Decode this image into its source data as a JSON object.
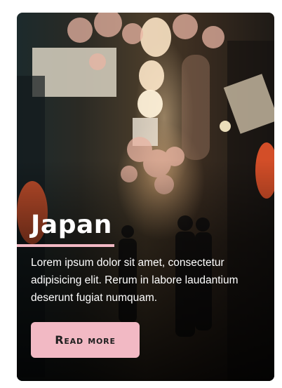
{
  "card": {
    "title": "Japan",
    "description": "Lorem ipsum dolor sit amet, consectetur adipisicing elit. Rerum in labore laudantium deserunt fugiat numquam.",
    "button_label": "Read more"
  },
  "colors": {
    "accent": "#f2b9c4",
    "text": "#ffffff",
    "button_text": "#1f1f1f"
  }
}
